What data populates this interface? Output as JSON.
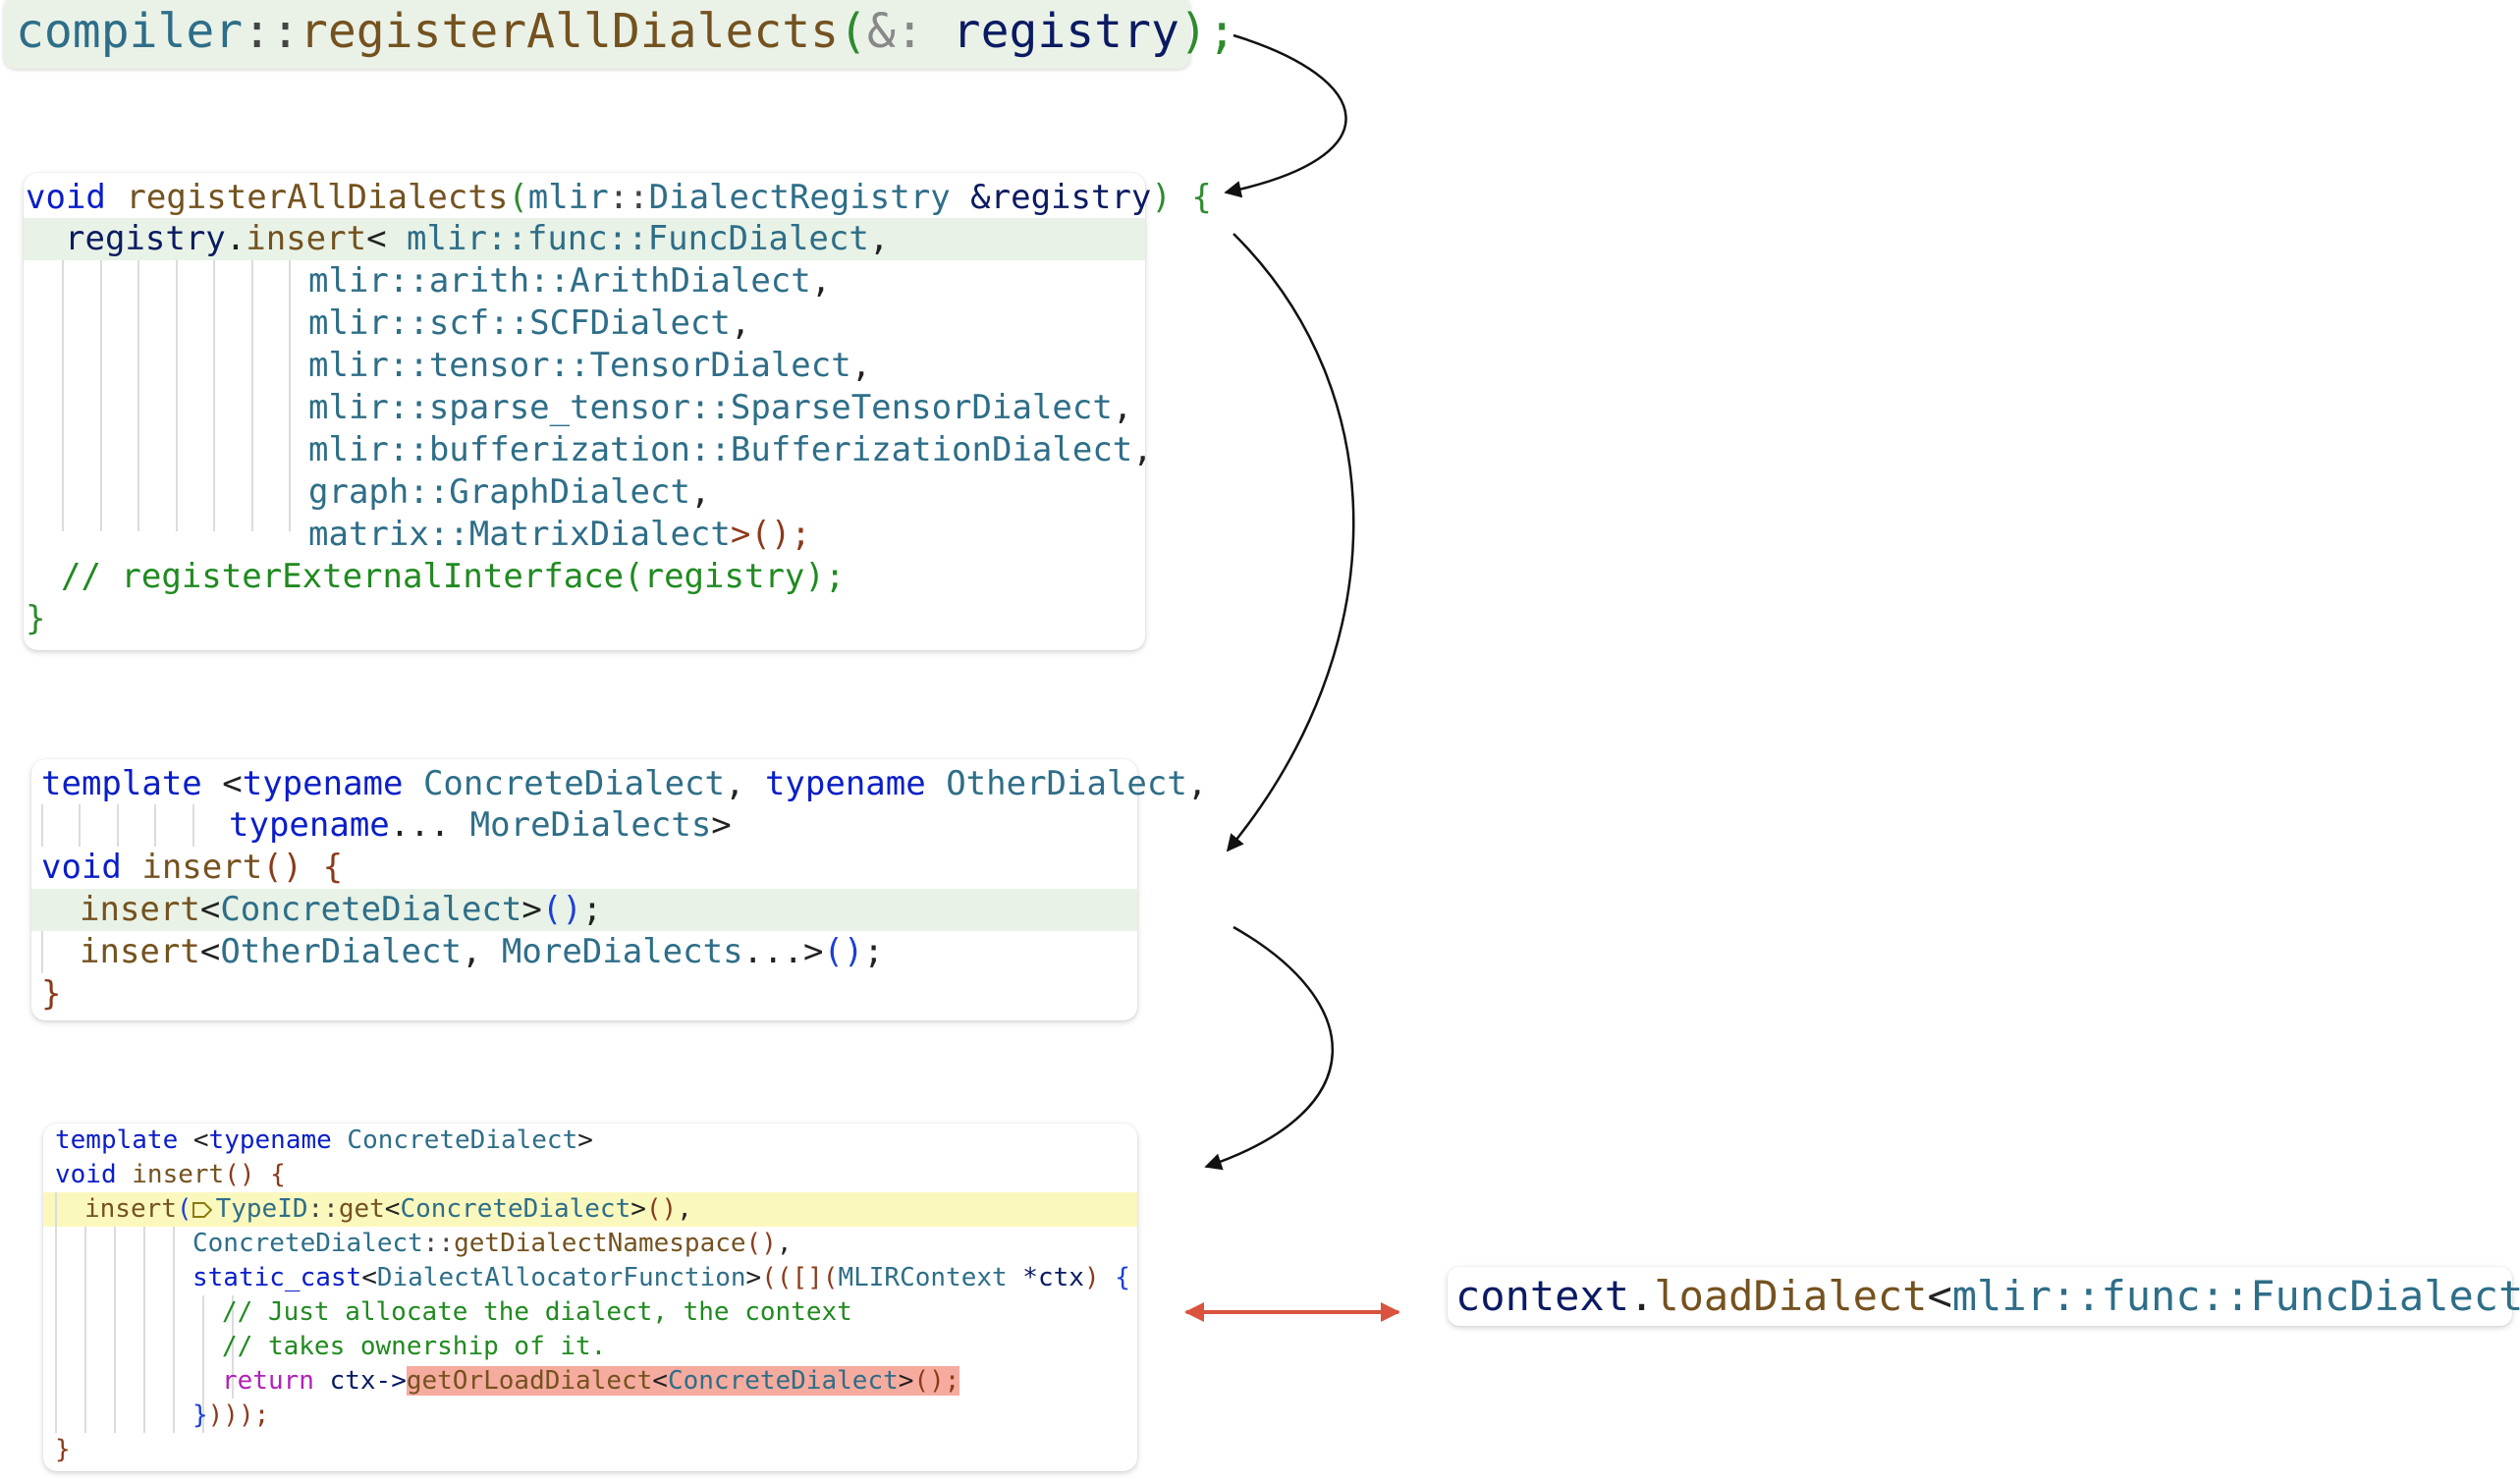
{
  "top_call": {
    "segments": [
      "compiler",
      "::",
      "registerAllDialects",
      "(",
      "&:",
      " ",
      "registry",
      ");"
    ]
  },
  "block1": {
    "line1": {
      "void": "void",
      "name": "registerAllDialects",
      "open": "(",
      "ns": "mlir",
      "sep": "::",
      "type": "DialectRegistry",
      "param": " &registry",
      "close": ")",
      "brace": " {"
    },
    "line2": {
      "obj": "registry",
      "dot": ".",
      "method": "insert",
      "lt": "< ",
      "ns": "mlir::func::",
      "type": "FuncDialect",
      "comma": ","
    },
    "dialects": [
      {
        "ns": "mlir::arith::",
        "type": "ArithDialect",
        "end": ","
      },
      {
        "ns": "mlir::scf::",
        "type": "SCFDialect",
        "end": ","
      },
      {
        "ns": "mlir::tensor::",
        "type": "TensorDialect",
        "end": ","
      },
      {
        "ns": "mlir::sparse_tensor::",
        "type": "SparseTensorDialect",
        "end": ","
      },
      {
        "ns": "mlir::bufferization::",
        "type": "BufferizationDialect",
        "end": ","
      },
      {
        "ns": "graph::",
        "type": "GraphDialect",
        "end": ","
      },
      {
        "ns": "matrix::",
        "type": "MatrixDialect",
        "end": ">();"
      }
    ],
    "comment": "// registerExternalInterface(registry);",
    "close": "}"
  },
  "block2": {
    "l1": {
      "kw1": "template",
      "lt": " <",
      "kw2": "typename",
      "t1": " ConcreteDialect",
      "c1": ", ",
      "kw3": "typename",
      "t2": " OtherDialect",
      "c2": ","
    },
    "l2": {
      "kw": "typename",
      "dots": "...",
      "t": " MoreDialects",
      "gt": ">"
    },
    "l3": {
      "kw": "void",
      "fn": " insert",
      "paren": "()",
      "brace": " {"
    },
    "l4": {
      "fn": "insert",
      "lt": "<",
      "t": "ConcreteDialect",
      "gt": ">",
      "paren": "()",
      "semi": ";"
    },
    "l5": {
      "fn": "insert",
      "lt": "<",
      "t1": "OtherDialect",
      "comma": ", ",
      "t2": "MoreDialects",
      "rest": "...>",
      "paren": "()",
      "semi": ";"
    },
    "close": "}"
  },
  "block3": {
    "l1": {
      "kw1": "template",
      "lt": " <",
      "kw2": "typename",
      "t": " ConcreteDialect",
      "gt": ">"
    },
    "l2": {
      "kw": "void",
      "fn": " insert",
      "paren": "()",
      "brace": " {"
    },
    "l3": {
      "fn": "insert",
      "paren": "(",
      "t": "TypeID",
      "sep": "::",
      "get": "get",
      "lt": "<",
      "t2": "ConcreteDialect",
      "gt": ">",
      "call": "()",
      "comma": ","
    },
    "l4": {
      "t": "ConcreteDialect",
      "sep": "::",
      "fn": "getDialectNamespace",
      "call": "()",
      "comma": ","
    },
    "l5": {
      "kw": "static_cast",
      "lt": "<",
      "t": "DialectAllocatorFunction",
      "gt": ">",
      "p": "(([](",
      "t2": "MLIRContext",
      "ptr": " *ctx",
      "close": ")",
      "brace": " {"
    },
    "l6": "// Just allocate the dialect, the context",
    "l7": "// takes ownership of it.",
    "l8": {
      "ret": "return",
      "obj": " ctx->",
      "fn": "getOrLoadDialect",
      "lt": "<",
      "t": "ConcreteDialect",
      "gt": ">",
      "call": "();"
    },
    "l9": {
      "brace": "}",
      "rest": ")));"
    },
    "close": "}"
  },
  "right_call": {
    "obj": "context",
    "dot": ".",
    "fn": "loadDialect",
    "lt": "<",
    "ns": "mlir::func::",
    "t": "FuncDialect",
    "gt": ">",
    "paren": "()",
    "semi": ";"
  },
  "colors": {
    "arrow": "#111111",
    "double_arrow": "#d9533f",
    "highlight_red": "#f6ab9f"
  }
}
